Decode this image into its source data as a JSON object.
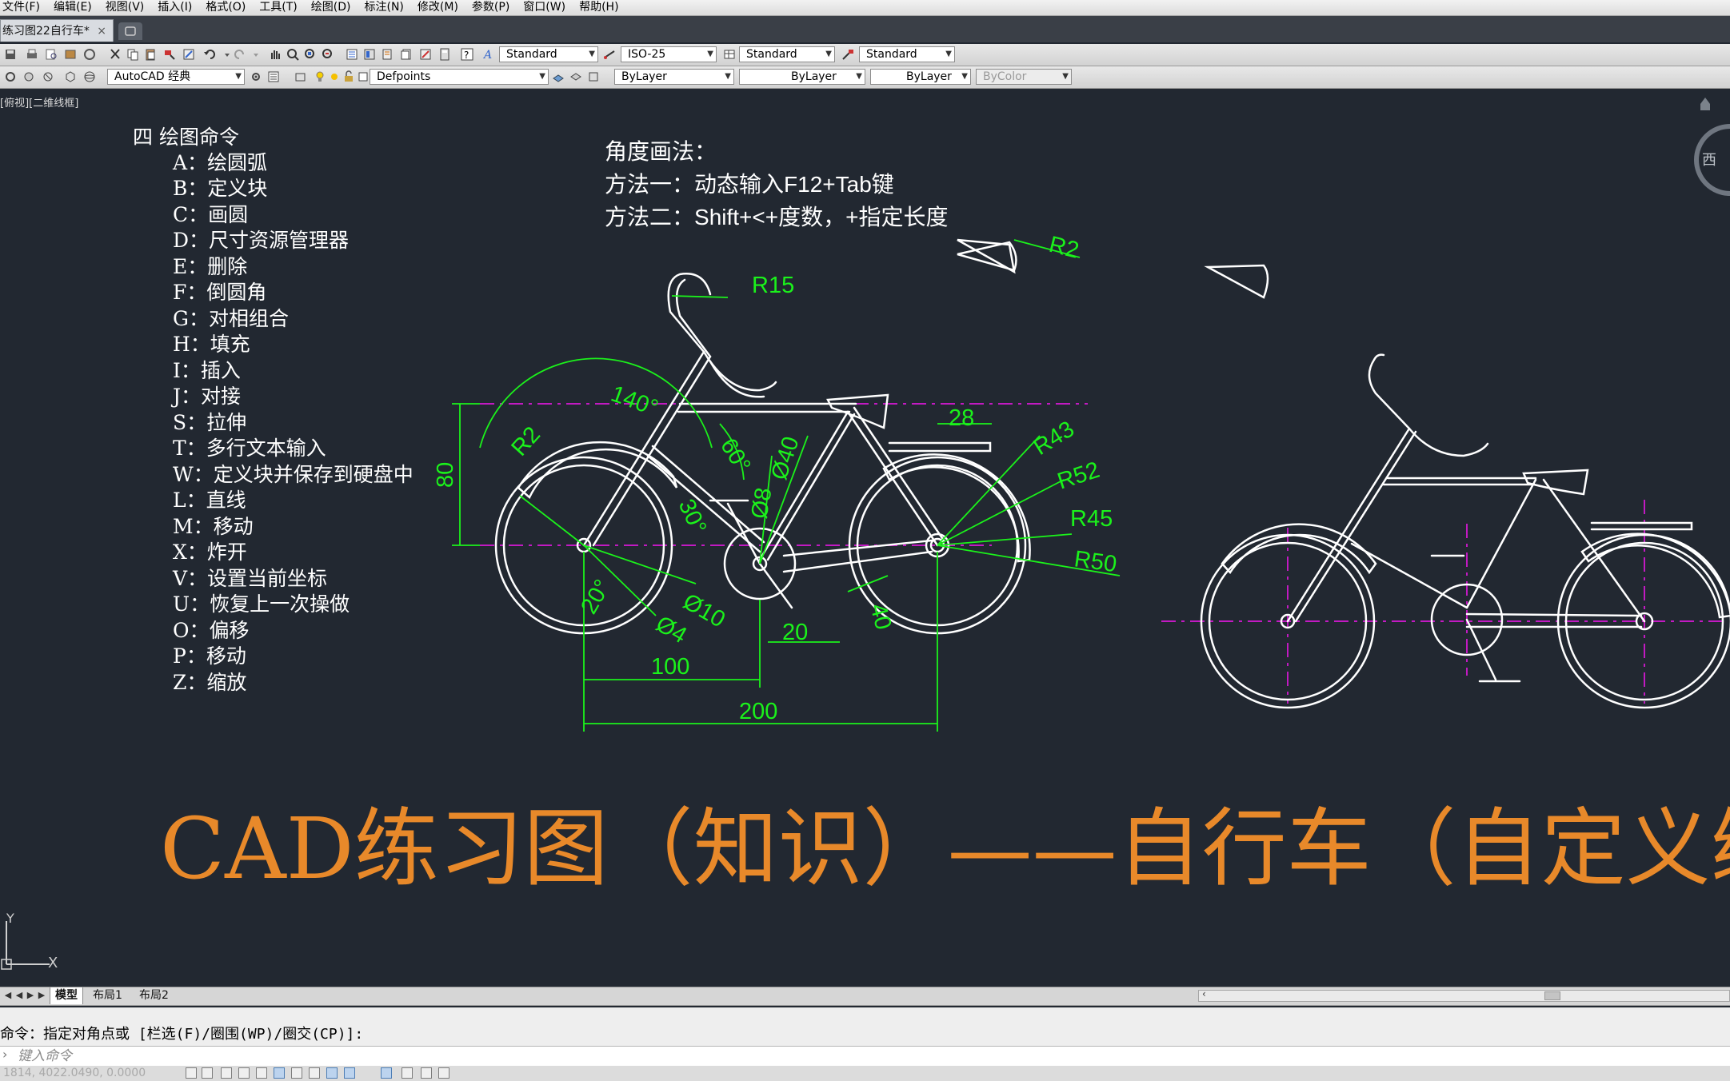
{
  "menu": [
    "文件(F)",
    "编辑(E)",
    "视图(V)",
    "插入(I)",
    "格式(O)",
    "工具(T)",
    "绘图(D)",
    "标注(N)",
    "修改(M)",
    "参数(P)",
    "窗口(W)",
    "帮助(H)"
  ],
  "tabs": {
    "active_label": "练习图22自行车*",
    "close": "×"
  },
  "toolbar1": {
    "text_style": "Standard",
    "dim_style": "ISO-25",
    "table_style": "Standard",
    "mleader_style": "Standard"
  },
  "toolbar2": {
    "workspace": "AutoCAD 经典",
    "layer": "Defpoints",
    "color": "ByLayer",
    "linetype": "ByLayer",
    "lineweight": "ByLayer",
    "plotstyle": "ByColor"
  },
  "viewport": {
    "label": "[俯视][二维线框]",
    "viewcube_label": "西"
  },
  "commands": {
    "heading": "四  绘图命令",
    "items": [
      "A：绘圆弧",
      "B：定义块",
      "C：画圆",
      "D：尺寸资源管理器",
      "E：删除",
      "F：倒圆角",
      "G：对相组合",
      "H：填充",
      "I：插入",
      "J：对接",
      "S：拉伸",
      "T：多行文本输入",
      "W：定义块并保存到硬盘中",
      "L：直线",
      "M：移动",
      "X：炸开",
      "V：设置当前坐标",
      "U：恢复上一次操做",
      "O：偏移",
      "P：移动",
      "Z：缩放"
    ]
  },
  "notes": {
    "line1": "角度画法：",
    "line2_prefix": "方法一：动态输入",
    "line2_keys": "F12+Tab",
    "line2_suffix": "键",
    "line3_prefix": "方法二：",
    "line3_keys": "Shift+<+",
    "line3_mid": "度数，",
    "line3_end": "+指定长度"
  },
  "dimensions": {
    "r15": "R15",
    "r2_top": "R2",
    "r2_left": "R2",
    "a140": "140°",
    "a60": "60°",
    "d40": "Ø40",
    "d8": "Ø8",
    "a30": "30°",
    "h80": "80",
    "w28": "28",
    "r43": "R43",
    "r52": "R52",
    "r45": "R45",
    "r50": "R50",
    "a20": "20°",
    "d10": "Ø10",
    "d4": "Ø4",
    "w20": "20",
    "w40": "40",
    "w100": "100",
    "w200": "200"
  },
  "title": "CAD练习图（知识）——自行车（自定义练习",
  "ucs": {
    "x": "X",
    "y": "Y"
  },
  "layout_tabs": [
    "模型",
    "布局1",
    "布局2"
  ],
  "command_line": {
    "history": "命令：指定对角点或 [栏选(F)/圈围(WP)/圈交(CP)]:",
    "placeholder": "键入命令"
  },
  "status": {
    "coords": "1814, 4022.0490, 0.0000"
  },
  "colors": {
    "canvas_bg": "#222831",
    "dimension": "#1bf21b",
    "geometry": "#ffffff",
    "centerline": "#c21ac2",
    "title": "#e8892a"
  }
}
